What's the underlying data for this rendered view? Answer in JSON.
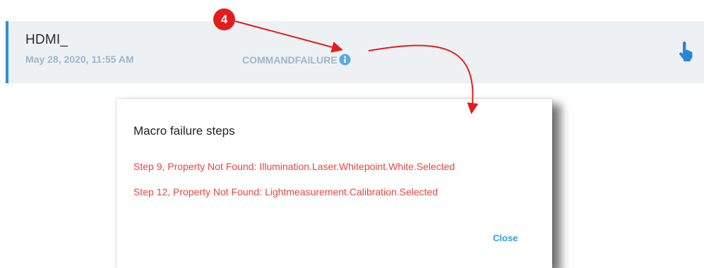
{
  "macro": {
    "name": "HDMI_",
    "date": "May 28, 2020, 11:55 AM",
    "status": "COMMANDFAILURE"
  },
  "icons": {
    "info": "info-icon",
    "run": "hand-pointer-icon"
  },
  "dialog": {
    "title": "Macro failure steps",
    "steps": [
      "Step 9, Property Not Found: Illumination.Laser.Whitepoint.White.Selected",
      "Step 12, Property Not Found: Lightmeasurement.Calibration.Selected"
    ],
    "close_label": "Close"
  },
  "annotation": {
    "callout_number": "4"
  },
  "colors": {
    "accent": "#2f8fd6",
    "error": "#e8463c",
    "callout": "#e31d1d",
    "link": "#2f9fe0"
  }
}
